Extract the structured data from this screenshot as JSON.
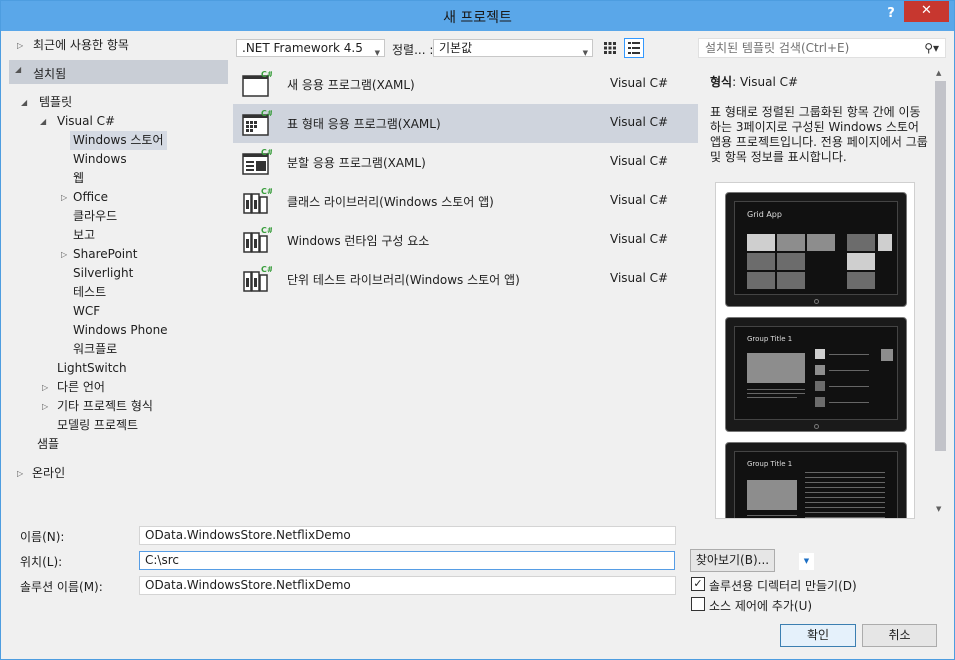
{
  "window": {
    "title": "새 프로젝트",
    "help": "?",
    "close": "✕"
  },
  "tree": {
    "recent": "최근에 사용한 항목",
    "installed": "설치됨",
    "templates": "템플릿",
    "visual_cs": "Visual C#",
    "items": [
      "Windows 스토어",
      "Windows",
      "웹",
      "Office",
      "클라우드",
      "보고",
      "SharePoint",
      "Silverlight",
      "테스트",
      "WCF",
      "Windows Phone",
      "워크플로"
    ],
    "lightswitch": "LightSwitch",
    "other_lang": "다른 언어",
    "other_proj": "기타 프로젝트 형식",
    "modeling": "모델링 프로젝트",
    "samples": "샘플",
    "online": "온라인"
  },
  "toolbar": {
    "framework": ".NET Framework 4.5",
    "sort_label": "정렬... :",
    "sort_value": "기본값"
  },
  "templates": [
    {
      "name": "새 응용 프로그램(XAML)",
      "lang": "Visual C#"
    },
    {
      "name": "표 형태 응용 프로그램(XAML)",
      "lang": "Visual C#"
    },
    {
      "name": "분할 응용 프로그램(XAML)",
      "lang": "Visual C#"
    },
    {
      "name": "클래스 라이브러리(Windows 스토어 앱)",
      "lang": "Visual C#"
    },
    {
      "name": "Windows 런타임 구성 요소",
      "lang": "Visual C#"
    },
    {
      "name": "단위 테스트 라이브러리(Windows 스토어 앱)",
      "lang": "Visual C#"
    }
  ],
  "search": {
    "placeholder": "설치된 템플릿 검색(Ctrl+E)"
  },
  "details": {
    "type_label": "형식",
    "type_value": "Visual C#",
    "description": "표 형태로 정렬된 그룹화된 항목 간에 이동하는 3페이지로 구성된 Windows 스토어 앱용 프로젝트입니다. 전용 페이지에서 그룹 및 항목 정보를 표시합니다.",
    "shot1_title": "Grid App",
    "shot2_title": "Group Title 1",
    "shot3_title": "Group Title 1"
  },
  "form": {
    "name_label": "이름(N):",
    "name_value": "OData.WindowsStore.NetflixDemo",
    "location_label": "위치(L):",
    "location_value": "C:\\src",
    "solution_label": "솔루션 이름(M):",
    "solution_value": "OData.WindowsStore.NetflixDemo",
    "browse": "찾아보기(B)...",
    "create_dir": "솔루션용 디렉터리 만들기(D)",
    "create_dir_checked": true,
    "add_source": "소스 제어에 추가(U)",
    "add_source_checked": false,
    "ok": "확인",
    "cancel": "취소"
  },
  "colors": {
    "titlebar": "#5aa7e9",
    "close": "#c7372f",
    "selected": "#cfd4dd"
  }
}
